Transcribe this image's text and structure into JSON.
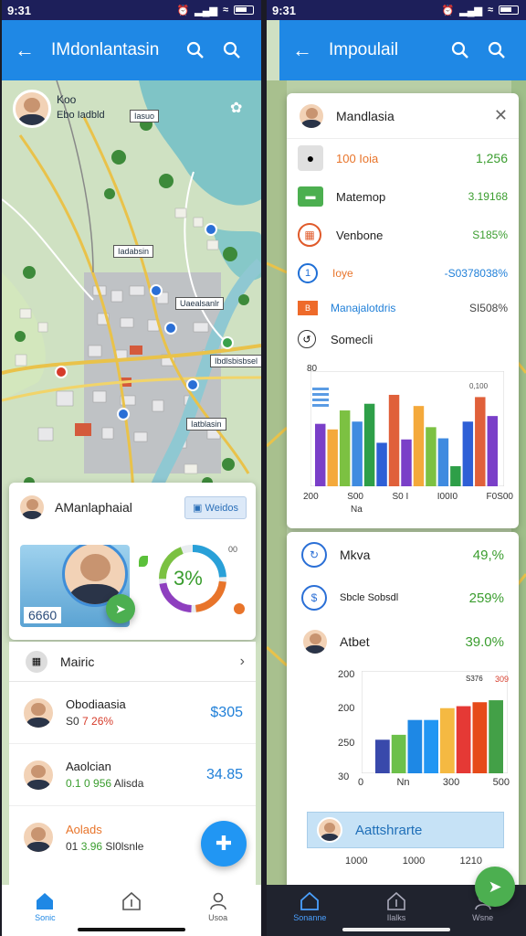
{
  "left": {
    "status": {
      "time": "9:31"
    },
    "appbar": {
      "title": "IMdonlantasin"
    },
    "map": {
      "profile": {
        "name": "Koo",
        "sub": "Ebo Iadbld",
        "tag": "Iasuo"
      },
      "labels": [
        "Iadabsin",
        "Uaealsanlr",
        "Ibdlsbisbsel",
        "Iatblasin"
      ]
    },
    "summary": {
      "name": "AManlaphaial",
      "chip": "Weidos",
      "stat": "6660",
      "percent": "3%",
      "gauge_side": "00"
    },
    "section": {
      "title": "Mairic"
    },
    "list": [
      {
        "name": "Obodiaasia",
        "sub_a": "S0",
        "sub_b": "7 26%",
        "value": "$305"
      },
      {
        "name": "Aaolcian",
        "sub_a": "0.1 0 956",
        "sub_b": "Alisda",
        "value": "34.85"
      },
      {
        "name": "Aolads",
        "sub_a": "01",
        "sub_b": "3.96",
        "sub_c": "Sl0lsnle",
        "value": ""
      }
    ],
    "nav": [
      {
        "label": "Sonic",
        "icon": "home-icon"
      },
      {
        "label": "",
        "icon": "upload-icon"
      },
      {
        "label": "Usoa",
        "icon": "profile-icon"
      }
    ]
  },
  "right": {
    "status": {
      "time": "9:31"
    },
    "appbar": {
      "title": "Impoulail"
    },
    "panel": {
      "title": "Mandlasia",
      "items": [
        {
          "label": "100 Ioia",
          "value": "1,256",
          "color": "#e8742a"
        },
        {
          "label": "Matemop",
          "value": "3.19168",
          "color": "#222"
        },
        {
          "label": "Venbone",
          "value": "S185%",
          "color": "#222"
        },
        {
          "label": "Ioye",
          "value": "-S0378038%",
          "color": "#e8742a"
        },
        {
          "label": "Manajalotdris",
          "value": "SI508%",
          "color": "#1f7fd8"
        },
        {
          "label": "Somecli",
          "value": "",
          "color": "#222"
        }
      ]
    },
    "chart1": {
      "ytop": "80",
      "xlabels": [
        "200",
        "S00",
        "S0 I",
        "I00I0",
        "F0S00"
      ],
      "xsub": "Na",
      "toplabel": "0,100"
    },
    "metrics": [
      {
        "label": "Mkva",
        "value": "49,%"
      },
      {
        "label": "Sbcle Sobsdl",
        "value": "259%"
      },
      {
        "label": "Atbet",
        "value": "39.0%"
      }
    ],
    "chart2": {
      "ylabels": [
        "200",
        "200",
        "250",
        "30"
      ],
      "xlabels": [
        "0",
        "Nn",
        "300",
        "500"
      ],
      "toplabel": "S376",
      "toplabel2": "309"
    },
    "banner": {
      "title": "Aattshrarte"
    },
    "banner_axis": [
      "1000",
      "1000",
      "1210"
    ],
    "nav": [
      {
        "label": "Sonanne",
        "icon": "home-icon"
      },
      {
        "label": "Ilalks",
        "icon": "upload-icon"
      },
      {
        "label": "Wsne",
        "icon": "profile-icon"
      }
    ]
  },
  "chart_data": [
    {
      "type": "bar",
      "categories": [
        "200",
        "S00",
        "S0 I",
        "I00I0",
        "F0S00"
      ],
      "series": [
        {
          "values": [
            56,
            58,
            82,
            53,
            58
          ]
        },
        {
          "values": [
            51,
            74,
            42,
            43,
            80
          ]
        },
        {
          "values": [
            68,
            39,
            72,
            18,
            63
          ]
        }
      ],
      "colors": [
        "#7a3fc8",
        "#f4a93b",
        "#7cc142",
        "#3f8be0",
        "#2e9f48",
        "#2e5fd6",
        "#e0603a"
      ],
      "ylim": [
        0,
        100
      ],
      "ytick_top": "80"
    },
    {
      "type": "bar",
      "categories": [
        "0",
        "Nn",
        "300",
        "500"
      ],
      "values": [
        34,
        39,
        54,
        54,
        66,
        68,
        72,
        74
      ],
      "colors": [
        "#3949ab",
        "#6cc04a",
        "#1e88e5",
        "#2196f3",
        "#f5b942",
        "#e53935",
        "#e64a19",
        "#43a047"
      ],
      "ylim": [
        0,
        100
      ]
    }
  ],
  "colors": {
    "primary": "#1f88e5",
    "positive": "#3a9d2e",
    "accent": "#e8742a",
    "statusbar": "#1d1f5a"
  }
}
